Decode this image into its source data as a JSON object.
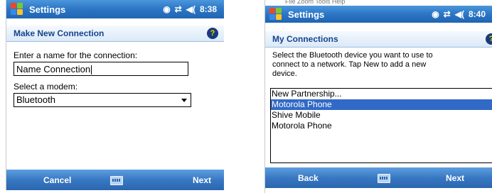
{
  "left": {
    "titlebar": {
      "title": "Settings",
      "clock": "8:38"
    },
    "header": "Make New Connection",
    "help": "?",
    "name_label": "Enter a name for the connection:",
    "name_value": "Name Connection",
    "modem_label": "Select a modem:",
    "modem_selected": "Bluetooth",
    "softkeys": {
      "left": "Cancel",
      "right": "Next"
    }
  },
  "right": {
    "menu_strip": "File    Zoom    Tools    Help",
    "titlebar": {
      "title": "Settings",
      "clock": "8:40"
    },
    "header": "My Connections",
    "help": "?",
    "description": "Select the Bluetooth device you want to use to connect to a network. Tap New to add a new device.",
    "devices": [
      {
        "name": "New Partnership...",
        "selected": false
      },
      {
        "name": "Motorola Phone",
        "selected": true
      },
      {
        "name": "Shive Mobile",
        "selected": false
      },
      {
        "name": "Motorola Phone",
        "selected": false
      }
    ],
    "softkeys": {
      "left": "Back",
      "right": "Next"
    }
  },
  "icons": [
    "windows-start-icon",
    "sync-icon",
    "connectivity-icon",
    "volume-icon",
    "help-icon",
    "keyboard-icon"
  ]
}
